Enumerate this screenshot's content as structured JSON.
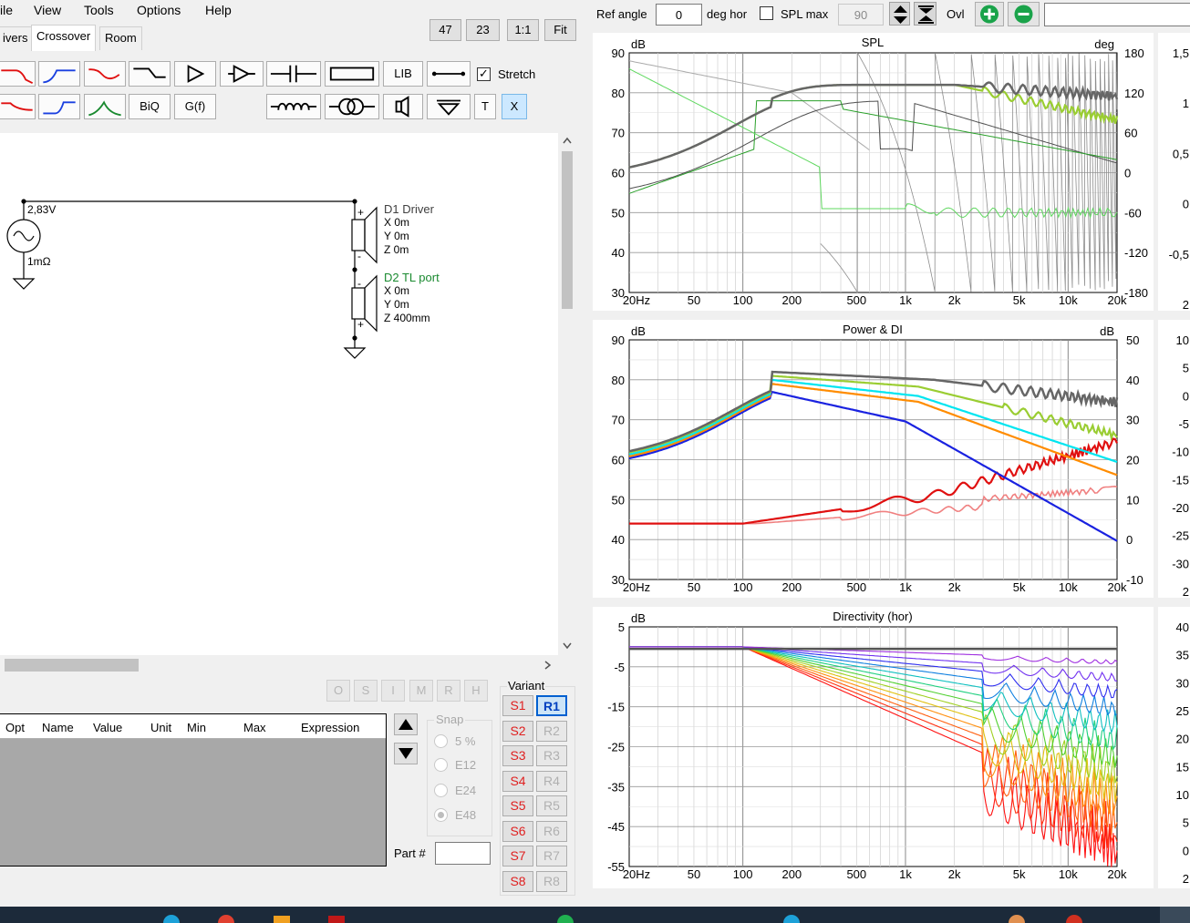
{
  "menu": {
    "file": "ile",
    "view": "View",
    "tools": "Tools",
    "options": "Options",
    "help": "Help"
  },
  "tabs": {
    "drivers": "ivers",
    "crossover": "Crossover",
    "room": "Room"
  },
  "view_buttons": {
    "b47": "47",
    "b23": "23",
    "b11": "1:1",
    "fit": "Fit"
  },
  "toolbar": {
    "ref_angle_label": "Ref angle",
    "ref_angle_value": "0",
    "deg_hor": "deg hor",
    "spl_max_label": "SPL max",
    "spl_max_value": "90",
    "ovl_label": "Ovl",
    "extra_value": ""
  },
  "palette": {
    "lib": "LIB",
    "stretch": "Stretch",
    "biq": "BiQ",
    "gf": "G(f)",
    "t": "T",
    "x": "X"
  },
  "schematic": {
    "source_voltage": "2,83V",
    "source_res": "1mΩ",
    "d1_name": "D1 Driver",
    "d1_x": "X 0m",
    "d1_y": "Y 0m",
    "d1_z": "Z 0m",
    "d2_name": "D2 TL port",
    "d2_x": "X 0m",
    "d2_y": "Y 0m",
    "d2_z": "Z 400mm",
    "plus": "+",
    "minus": "-"
  },
  "opt_buttons": [
    "O",
    "S",
    "I",
    "M",
    "R",
    "H"
  ],
  "parts_table": {
    "columns": [
      "Opt",
      "Name",
      "Value",
      "Unit",
      "Min",
      "Max",
      "Expression"
    ]
  },
  "snap": {
    "label": "Snap",
    "options": [
      "5 %",
      "E12",
      "E24",
      "E48"
    ],
    "selected": "E48"
  },
  "part_number": {
    "label": "Part #",
    "value": ""
  },
  "variant": {
    "label": "Variant",
    "s": [
      "S1",
      "S2",
      "S3",
      "S4",
      "S5",
      "S6",
      "S7",
      "S8"
    ],
    "r": [
      "R1",
      "R2",
      "R3",
      "R4",
      "R5",
      "R6",
      "R7",
      "R8"
    ],
    "selected_r": "R1"
  },
  "graphs": {
    "spl": {
      "title": "SPL",
      "left_unit": "dB",
      "right_unit": "deg",
      "y_left": [
        "90",
        "80",
        "70",
        "60",
        "50",
        "40",
        "30"
      ],
      "y_right": [
        "180",
        "120",
        "60",
        "0",
        "-60",
        "-120",
        "-180"
      ]
    },
    "power": {
      "title": "Power & DI",
      "left_unit": "dB",
      "right_unit": "dB",
      "y_left": [
        "90",
        "80",
        "70",
        "60",
        "50",
        "40",
        "30"
      ],
      "y_right": [
        "50",
        "40",
        "30",
        "20",
        "10",
        "0",
        "-10"
      ]
    },
    "directivity": {
      "title": "Directivity (hor)",
      "left_unit": "dB",
      "y_left": [
        "5",
        "-5",
        "-15",
        "-25",
        "-35",
        "-45",
        "-55"
      ]
    },
    "x_ticks": [
      "20Hz",
      "50",
      "100",
      "200",
      "500",
      "1k",
      "2k",
      "5k",
      "10k",
      "20k"
    ],
    "side_spl": [
      "1,5",
      "1",
      "0,5",
      "0",
      "-0,5",
      "2"
    ],
    "side_power": [
      "10",
      "5",
      "0",
      "-5",
      "-10",
      "-15",
      "-20",
      "-25",
      "-30",
      "2"
    ],
    "side_dir": [
      "40",
      "35",
      "30",
      "25",
      "20",
      "15",
      "10",
      "5",
      "0",
      "2"
    ]
  },
  "colors": {
    "spl_gray": "#666666",
    "spl_green": "#9acd32",
    "blue": "#1a22e0",
    "red": "#e01010",
    "cyan": "#00e5f0",
    "orange": "#ff8c00"
  }
}
